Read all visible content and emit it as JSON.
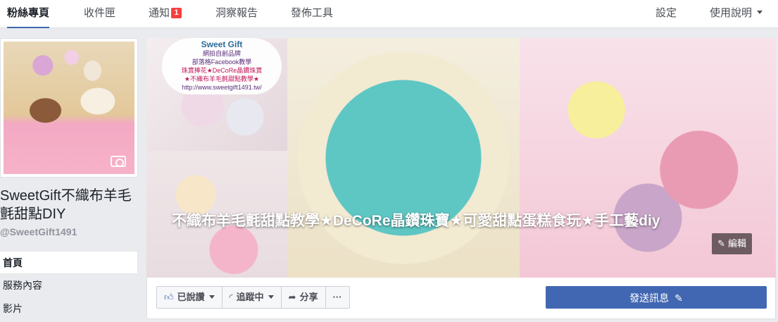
{
  "topnav": {
    "tabs": [
      {
        "label": "粉絲專頁"
      },
      {
        "label": "收件匣"
      },
      {
        "label": "通知"
      },
      {
        "label": "洞察報告"
      },
      {
        "label": "發佈工具"
      }
    ],
    "notification_count": "1",
    "settings_label": "設定",
    "help_label": "使用說明"
  },
  "sidebar": {
    "page_name": "SweetGift不織布羊毛氈甜點DIY",
    "page_handle": "@SweetGift1491",
    "items": [
      {
        "label": "首頁"
      },
      {
        "label": "服務內容"
      },
      {
        "label": "影片"
      }
    ]
  },
  "cover": {
    "brand_title": "Sweet Gift",
    "brand_line1": "網拍自創品牌",
    "brand_line2": "部落格Facebook教學",
    "brand_line3": "珠寶捧花★DeCoRe晶鑽珠寶",
    "brand_line4": "★不織布羊毛氈甜點教學★",
    "brand_url": "http://www.sweetgift1491.tw/",
    "caption": "不織布羊毛氈甜點教學★DeCoRe晶鑽珠寶★可愛甜點蛋糕食玩★手工藝diy",
    "edit_label": "編輯"
  },
  "actions": {
    "liked_label": "已說讚",
    "following_label": "追蹤中",
    "share_label": "分享",
    "more_label": "···",
    "message_label": "發送訊息"
  },
  "icons": {
    "like": "thumbs-up-icon",
    "follow": "rss-icon",
    "share": "share-arrow-icon",
    "edit": "pencil-icon",
    "camera": "camera-icon"
  },
  "colors": {
    "brand_blue": "#4267b2",
    "badge_red": "#fa3e3e",
    "background": "#e9ebee"
  }
}
